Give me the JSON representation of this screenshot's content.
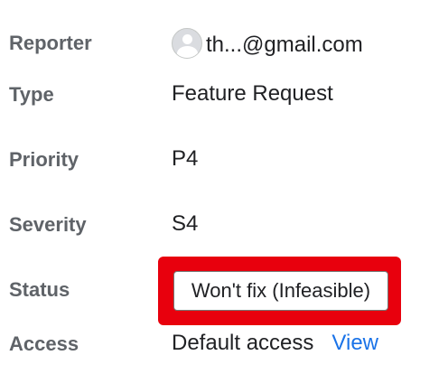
{
  "fields": {
    "reporter": {
      "label": "Reporter",
      "value": "th...@gmail.com",
      "icon": "avatar-icon"
    },
    "type": {
      "label": "Type",
      "value": "Feature Request"
    },
    "priority": {
      "label": "Priority",
      "value": "P4"
    },
    "severity": {
      "label": "Severity",
      "value": "S4"
    },
    "status": {
      "label": "Status",
      "value": "Won't fix (Infeasible)"
    },
    "access": {
      "label": "Access",
      "value": "Default access",
      "link": "View"
    }
  },
  "colors": {
    "label": "#5f6368",
    "value": "#202124",
    "link": "#1a73e8",
    "highlight": "#e8000d"
  }
}
